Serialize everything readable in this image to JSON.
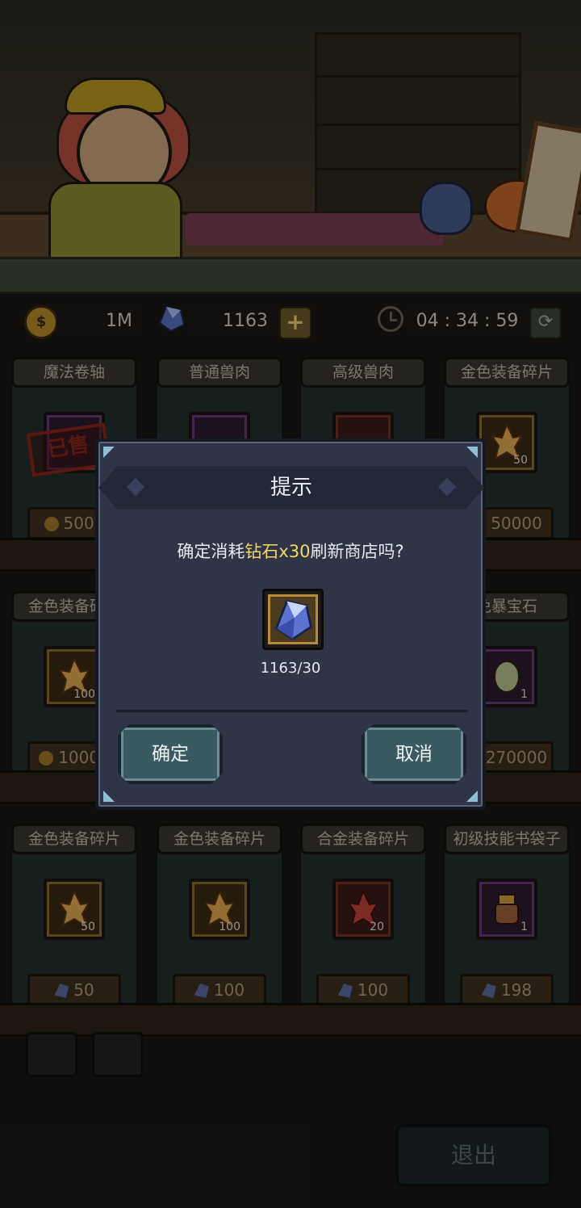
{
  "colors": {
    "highlight": "#f2d76a",
    "dialog_bg": "#2f3446",
    "button_bg": "#3a5a62"
  },
  "topbar": {
    "coin_value": "1M",
    "gem_value": "1163",
    "timer": "04 : 34 : 59"
  },
  "shop": {
    "row1": [
      {
        "title": "魔法卷轴",
        "qty": "",
        "price": "5000",
        "currency": "coin",
        "sold": "已售"
      },
      {
        "title": "普通兽肉",
        "qty": "",
        "price": "",
        "currency": "coin"
      },
      {
        "title": "高级兽肉",
        "qty": "",
        "price": "",
        "currency": "coin"
      },
      {
        "title": "金色装备碎片",
        "qty": "50",
        "price": "50000",
        "currency": "coin"
      }
    ],
    "row2": [
      {
        "title": "金色装备碎片",
        "qty": "100",
        "price": "10000",
        "currency": "coin"
      },
      {
        "title": "免暴宝石",
        "qty": "1",
        "price": "270000",
        "currency": "coin"
      }
    ],
    "row3": [
      {
        "title": "金色装备碎片",
        "qty": "50",
        "price": "50",
        "currency": "gem"
      },
      {
        "title": "金色装备碎片",
        "qty": "100",
        "price": "100",
        "currency": "gem"
      },
      {
        "title": "合金装备碎片",
        "qty": "20",
        "price": "100",
        "currency": "gem"
      },
      {
        "title": "初级技能书袋子",
        "qty": "1",
        "price": "198",
        "currency": "gem"
      }
    ]
  },
  "bottom": {
    "exit_label": "退出",
    "icons": [
      "chest-icon",
      "gift-icon"
    ]
  },
  "dialog": {
    "title": "提示",
    "message_prefix": "确定消耗",
    "message_highlight": "钻石x30",
    "message_suffix": "刷新商店吗?",
    "count": "1163/30",
    "confirm_label": "确定",
    "cancel_label": "取消"
  }
}
